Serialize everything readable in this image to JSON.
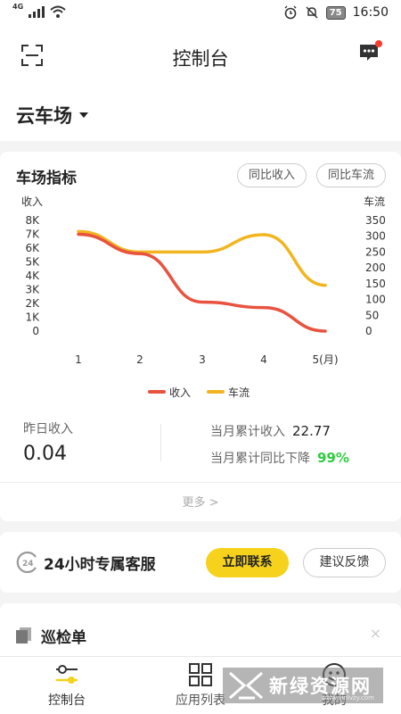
{
  "status_bar": {
    "network": "4G",
    "time": "16:50",
    "battery": "75"
  },
  "header": {
    "title": "控制台"
  },
  "lot": {
    "name": "云车场"
  },
  "metrics": {
    "title": "车场指标",
    "btn_income": "同比收入",
    "btn_traffic": "同比车流"
  },
  "chart_data": {
    "type": "line",
    "categories": [
      "1",
      "2",
      "3",
      "4",
      "5(月)"
    ],
    "y_left": {
      "label": "收入",
      "ticks": [
        "8K",
        "7K",
        "6K",
        "5K",
        "4K",
        "3K",
        "2K",
        "1K",
        "0"
      ],
      "range": [
        0,
        8000
      ]
    },
    "y_right": {
      "label": "车流",
      "ticks": [
        "350",
        "300",
        "250",
        "200",
        "150",
        "100",
        "50",
        "0"
      ],
      "range": [
        0,
        350
      ]
    },
    "series": [
      {
        "name": "收入",
        "axis": "left",
        "color": "#e8533f",
        "values": [
          7000,
          5600,
          2100,
          1700,
          0
        ]
      },
      {
        "name": "车流",
        "axis": "right",
        "color": "#f2b51f",
        "values": [
          315,
          250,
          250,
          305,
          145
        ]
      }
    ],
    "legend": "bottom-center",
    "grid": false
  },
  "stats": {
    "yesterday_label": "昨日收入",
    "yesterday_value": "0.04",
    "month_label": "当月累计收入",
    "month_value": "22.77",
    "yoy_label": "当月累计同比下降",
    "yoy_value": "99%",
    "more": "更多 >"
  },
  "service": {
    "title": "24小时专属客服",
    "contact": "立即联系",
    "feedback": "建议反馈"
  },
  "patrol": {
    "title": "巡检单",
    "close": "×"
  },
  "tabs": [
    {
      "label": "控制台"
    },
    {
      "label": "应用列表"
    },
    {
      "label": "我的"
    }
  ],
  "watermark": {
    "text": "新绿资源网",
    "sub": "www.xinlvzy.com"
  },
  "colors": {
    "accent": "#f6d21c",
    "income": "#e8533f",
    "traffic": "#f2b51f",
    "down_green": "#2ecc40"
  }
}
